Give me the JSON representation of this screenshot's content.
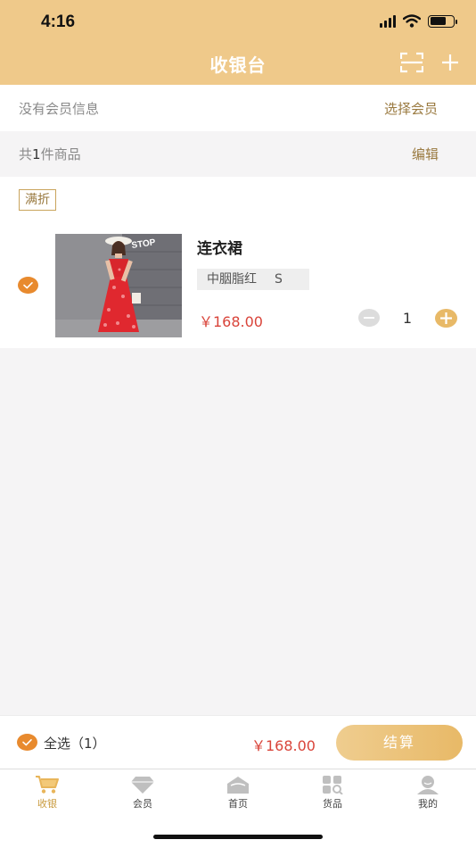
{
  "status": {
    "time": "4:16"
  },
  "header": {
    "title": "收银台"
  },
  "member": {
    "info": "没有会员信息",
    "select_label": "选择会员"
  },
  "cart_summary": {
    "prefix": "共",
    "count": "1",
    "suffix": "件商品",
    "edit_label": "编辑"
  },
  "promo": {
    "tag": "满折"
  },
  "item": {
    "name": "连衣裙",
    "color": "中胭脂红",
    "size": "S",
    "price": "￥168.00",
    "quantity": "1",
    "image_sign_text": "STOP"
  },
  "bottom": {
    "select_all_label": "全选（1）",
    "total": "￥168.00",
    "checkout_label": "结算"
  },
  "tabs": [
    {
      "label": "收银",
      "icon": "cart-icon",
      "active": true
    },
    {
      "label": "会员",
      "icon": "diamond-icon",
      "active": false
    },
    {
      "label": "首页",
      "icon": "home-icon",
      "active": false
    },
    {
      "label": "货品",
      "icon": "grid-icon",
      "active": false
    },
    {
      "label": "我的",
      "icon": "person-icon",
      "active": false
    }
  ],
  "colors": {
    "header_bg": "#efc98a",
    "accent": "#e88a2e",
    "price": "#d9443a",
    "link": "#9a7a40",
    "active_tab": "#c99a3c"
  }
}
